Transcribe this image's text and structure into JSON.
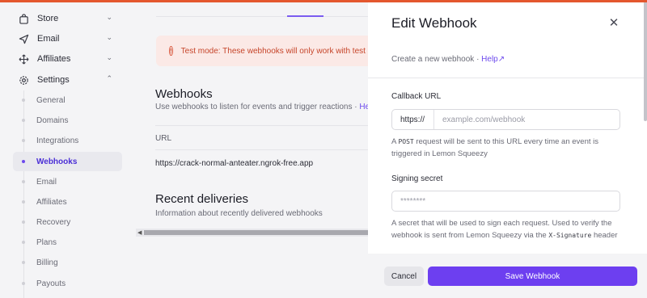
{
  "sidebar": {
    "items": [
      {
        "label": "Store",
        "icon": "bag-icon"
      },
      {
        "label": "Email",
        "icon": "send-icon"
      },
      {
        "label": "Affiliates",
        "icon": "move-icon"
      },
      {
        "label": "Settings",
        "icon": "gear-icon"
      }
    ],
    "settings_items": [
      "General",
      "Domains",
      "Integrations",
      "Webhooks",
      "Email",
      "Affiliates",
      "Recovery",
      "Plans",
      "Billing",
      "Payouts"
    ],
    "active": "Webhooks"
  },
  "main": {
    "alert": "Test mode: These webhooks will only work with test m",
    "webhooks_title": "Webhooks",
    "webhooks_desc": "Use webhooks to listen for events and trigger reactions · ",
    "help_label": "Help",
    "table_header": "URL",
    "webhook_url": "https://crack-normal-anteater.ngrok-free.app",
    "recent_title": "Recent deliveries",
    "recent_desc": "Information about recently delivered webhooks"
  },
  "panel": {
    "title": "Edit Webhook",
    "subtitle": "Create a new webhook · ",
    "help_label": "Help",
    "callback_label": "Callback URL",
    "callback_prefix": "https://",
    "callback_placeholder": "example.com/webhook",
    "callback_hint_code": "POST",
    "callback_hint_rest": " request will be sent to this URL every time an event is triggered in Lemon Squeezy",
    "callback_hint_a": "A ",
    "secret_label": "Signing secret",
    "secret_placeholder": "********",
    "secret_hint": "A secret that will be used to sign each request. Used to verify the webhook is sent from Lemon Squeezy via the ",
    "secret_hint_code": "X-Signature",
    "secret_hint_end": " header",
    "cancel_label": "Cancel",
    "save_label": "Save Webhook"
  },
  "colors": {
    "accent": "#6d3ff0",
    "alert_bg": "#fbe9e6",
    "alert_text": "#c6452a"
  }
}
